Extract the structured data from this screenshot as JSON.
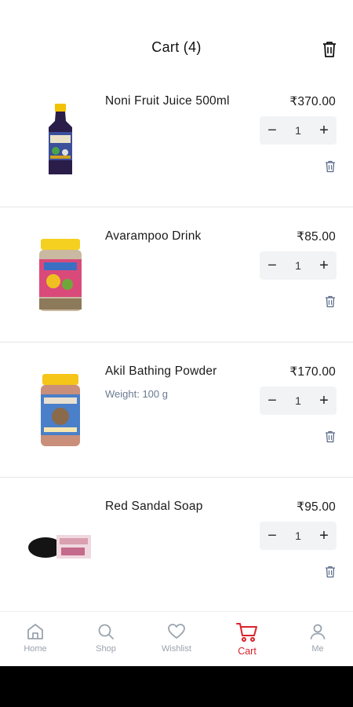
{
  "header": {
    "title": "Cart (4)"
  },
  "items": [
    {
      "name": "Noni Fruit Juice 500ml",
      "price": "₹370.00",
      "quantity": "1",
      "variant": ""
    },
    {
      "name": "Avarampoo Drink",
      "price": "₹85.00",
      "quantity": "1",
      "variant": ""
    },
    {
      "name": "Akil Bathing Powder",
      "price": "₹170.00",
      "quantity": "1",
      "variant": "Weight: 100 g"
    },
    {
      "name": "Red Sandal Soap",
      "price": "₹95.00",
      "quantity": "1",
      "variant": ""
    }
  ],
  "stepper": {
    "minus": "−",
    "plus": "+"
  },
  "nav": [
    {
      "label": "Home",
      "icon": "home-icon",
      "active": false
    },
    {
      "label": "Shop",
      "icon": "search-icon",
      "active": false
    },
    {
      "label": "Wishlist",
      "icon": "heart-icon",
      "active": false
    },
    {
      "label": "Cart",
      "icon": "cart-icon",
      "active": true
    },
    {
      "label": "Me",
      "icon": "user-icon",
      "active": false
    }
  ],
  "colors": {
    "accent": "#d9232d",
    "muted": "#9aa3ad",
    "stepper_bg": "#f2f3f5",
    "variant_text": "#6b7a90"
  }
}
